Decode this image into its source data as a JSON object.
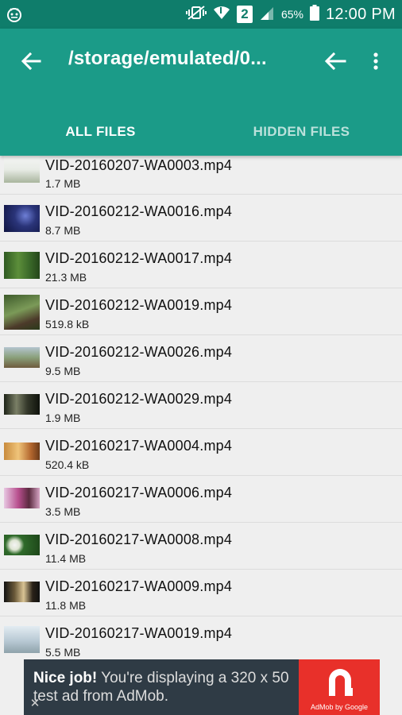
{
  "status": {
    "battery": "65%",
    "time": "12:00 PM",
    "sim_badge": "2"
  },
  "toolbar": {
    "path": "/storage/emulated/0..."
  },
  "tabs": [
    {
      "label": "ALL FILES",
      "active": true
    },
    {
      "label": "HIDDEN FILES",
      "active": false
    }
  ],
  "files": [
    {
      "name": "VID-20160207-WA0003.mp4",
      "size": "1.7 MB"
    },
    {
      "name": "VID-20160212-WA0016.mp4",
      "size": "8.7 MB"
    },
    {
      "name": "VID-20160212-WA0017.mp4",
      "size": "21.3 MB"
    },
    {
      "name": "VID-20160212-WA0019.mp4",
      "size": "519.8 kB"
    },
    {
      "name": "VID-20160212-WA0026.mp4",
      "size": "9.5 MB"
    },
    {
      "name": "VID-20160212-WA0029.mp4",
      "size": "1.9 MB"
    },
    {
      "name": "VID-20160217-WA0004.mp4",
      "size": "520.4 kB"
    },
    {
      "name": "VID-20160217-WA0006.mp4",
      "size": "3.5 MB"
    },
    {
      "name": "VID-20160217-WA0008.mp4",
      "size": "11.4 MB"
    },
    {
      "name": "VID-20160217-WA0009.mp4",
      "size": "11.8 MB"
    },
    {
      "name": "VID-20160217-WA0019.mp4",
      "size": "5.5 MB"
    }
  ],
  "ad": {
    "headline": "Nice job!",
    "body": " You're displaying a 320 x 50 test ad from AdMob.",
    "brand": "AdMob by Google",
    "close": "✕"
  },
  "colors": {
    "status_bar": "#0f7d6b",
    "toolbar": "#1b9b88",
    "list_bg": "#efefef",
    "ad_bg": "#2f3b45",
    "ad_brand": "#e8302a"
  }
}
